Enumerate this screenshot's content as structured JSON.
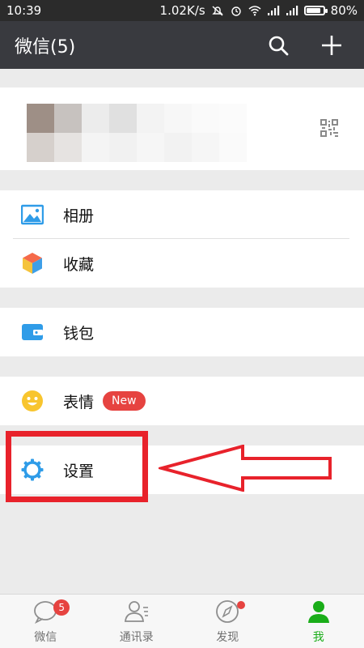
{
  "status_bar": {
    "time": "10:39",
    "network_speed": "1.02K/s",
    "battery": "80%"
  },
  "header": {
    "title": "微信(5)",
    "search_icon": "search-icon",
    "add_icon": "plus-icon"
  },
  "profile": {
    "qr_icon": "qr-code-icon"
  },
  "menu": {
    "album": "相册",
    "favorites": "收藏",
    "wallet": "钱包",
    "stickers": "表情",
    "stickers_badge": "New",
    "settings": "设置"
  },
  "tabs": [
    {
      "label": "微信",
      "badge": "5",
      "icon": "chat-icon"
    },
    {
      "label": "通讯录",
      "icon": "contacts-icon"
    },
    {
      "label": "发现",
      "icon": "compass-icon"
    },
    {
      "label": "我",
      "icon": "person-icon"
    }
  ],
  "colors": {
    "titlebar": "#393a3f",
    "accent_green": "#1aad19",
    "badge_red": "#e64340",
    "annotation_red": "#e8222b"
  }
}
